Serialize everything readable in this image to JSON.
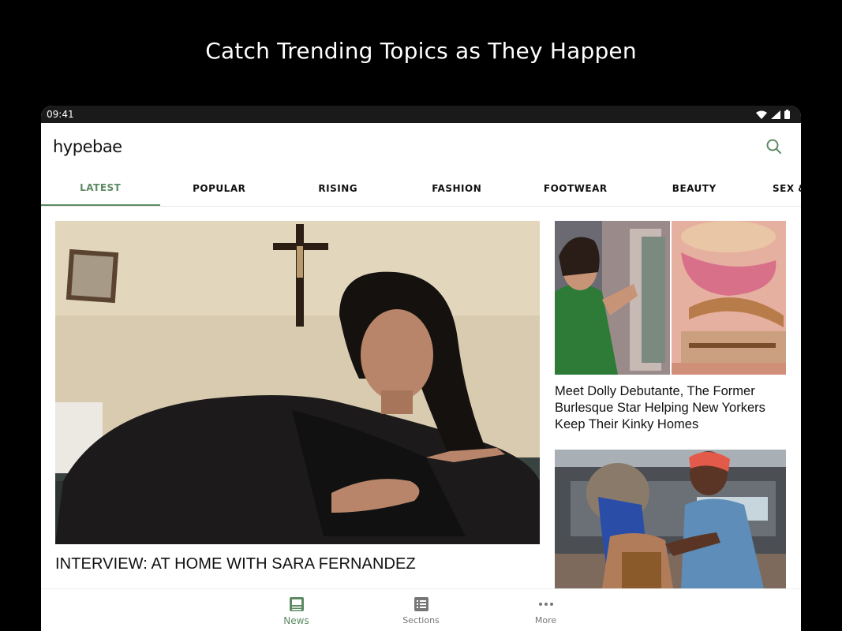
{
  "promo": {
    "headline": "Catch Trending Topics as They Happen"
  },
  "status_bar": {
    "time": "09:41"
  },
  "app": {
    "logo": "hypebae"
  },
  "tabs": [
    {
      "label": "LATEST",
      "active": true
    },
    {
      "label": "POPULAR"
    },
    {
      "label": "RISING"
    },
    {
      "label": "FASHION"
    },
    {
      "label": "FOOTWEAR"
    },
    {
      "label": "BEAUTY"
    },
    {
      "label": "SEX &"
    }
  ],
  "articles": {
    "hero": {
      "title": "INTERVIEW: AT HOME WITH SARA FERNANDEZ"
    },
    "side1": {
      "title": "Meet Dolly Debutante, The Former Burlesque Star Helping New Yorkers Keep Their Kinky Homes"
    }
  },
  "bottom_nav": [
    {
      "label": "News",
      "icon": "news-icon",
      "active": true
    },
    {
      "label": "Sections",
      "icon": "sections-icon"
    },
    {
      "label": "More",
      "icon": "more-dots-icon"
    }
  ],
  "colors": {
    "accent": "#5d8a63",
    "background": "#000000"
  }
}
